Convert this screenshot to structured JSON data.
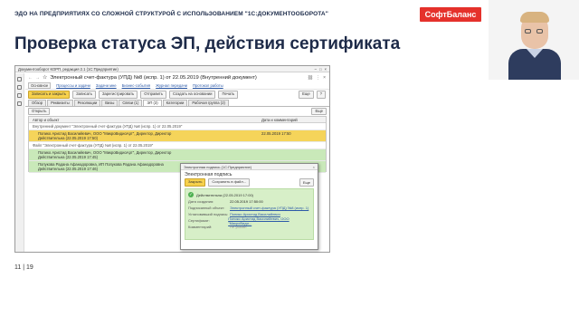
{
  "slide": {
    "header_text": "ЭДО НА ПРЕДПРИЯТИЯХ СО СЛОЖНОЙ СТРУКТУРОЙ С ИСПОЛЬЗОВАНИЕМ \"1С:ДОКУМЕНТООБОРОТА\"",
    "logo": "СофтБаланс",
    "title": "Проверка статуса ЭП, действия сертификата",
    "page_number": "11",
    "page_total": "19"
  },
  "window": {
    "title": "Документооборот КОРП, редакция 2.1 (1С:Предприятие)",
    "doc_title": "Электронный счет-фактура (УПД) №8 (испр. 1) от 22.05.2019 (Внутренний документ)",
    "links": [
      "Основное",
      "Процессы и задачи",
      "Задачи мне",
      "Бизнес-события",
      "Журнал передачи",
      "Протокол работы"
    ],
    "toolbar": {
      "primary": "Записать и закрыть",
      "write": "Записать",
      "register": "Зарегистрировать",
      "send": "Отправить",
      "create_basis": "Создать на основании",
      "print": "Печать",
      "more": "Еще",
      "help": "?"
    },
    "tabs": [
      "Обзор",
      "Реквизиты",
      "Резолюции",
      "Визы",
      "Связи (1)",
      "ЭП (3)",
      "Категории",
      "Рабочая группа (2)"
    ],
    "sub_open": "Открыть",
    "sub_more": "Еще",
    "grid": {
      "headers": [
        "Автор и объект",
        "Дата и комментарий"
      ],
      "rows": [
        {
          "text": "Внутренний документ \"Электронный счет-фактура (УПД) №8 (испр. 1) от 22.05.2019\"",
          "date": "",
          "style": "group"
        },
        {
          "text": "Попико Аристид Василийевич, ООО \"МикроВидиоАрт\", Директор, Директор\nДействительна (22.05.2019 17:50)",
          "date": "22.05.2019 17:50",
          "style": "yellow"
        },
        {
          "text": "Файл \"Электронный счет-фактура (УПД) №8 (испр. 1) от 22.05.2019\"",
          "date": "",
          "style": "group"
        },
        {
          "text": "Попико Аристид Василийевич, ООО \"МикроВидиоАрт\", Директор, Директор\nДействительна (22.05.2019 17:45)",
          "date": "",
          "style": "green"
        },
        {
          "text": "Попукова Радана Афанадоровна, ИП Попукова Радана Афанадоровна\nДействительна (22.05.2019 17:46)",
          "date": "",
          "style": "green"
        }
      ]
    }
  },
  "popup": {
    "window_title": "Электронная подпись (1С:Предприятие)",
    "heading": "Электронная подпись",
    "close": "Закрыть",
    "save_file": "Сохранить в файл...",
    "more": "Еще",
    "status": "Действительна (22.05.2019 17:00)",
    "fields": [
      {
        "label": "Дата создания:",
        "value": "22.05.2019 17:50:00",
        "kind": "plain"
      },
      {
        "label": "Подписанный объект:",
        "value": "Электронный счет-фактура (УПД) №8 (испр. 1)",
        "kind": "link"
      },
      {
        "label": "Установивший подпись:",
        "value": "Попико Аристид Василийевич",
        "kind": "link"
      },
      {
        "label": "Сертификат:",
        "value": "Попико Аристид Василийевич, ООО \"МикроВиди...",
        "kind": "link"
      },
      {
        "label": "Комментарий:",
        "value": "Не указан",
        "kind": "muted"
      }
    ]
  }
}
